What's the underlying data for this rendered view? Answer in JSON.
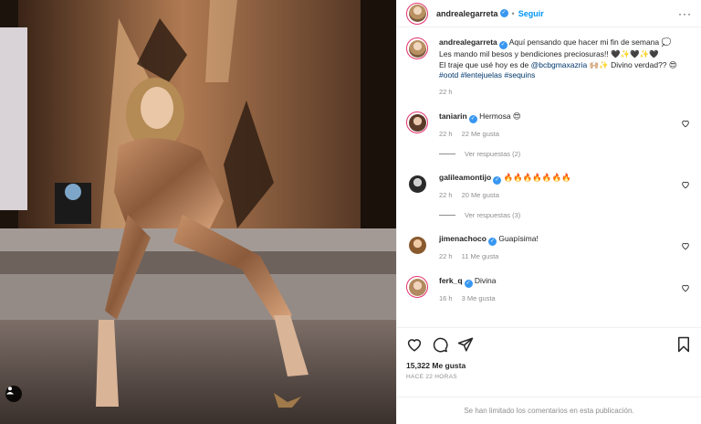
{
  "post": {
    "username": "andrealegarreta",
    "follow_label": "Seguir",
    "more_label": "···",
    "caption": {
      "username": "andrealegarreta",
      "line1": "Aquí pensando que hacer mi fin de semana 💭",
      "line2": "Les mando mil besos y bendiciones preciosuras!! 🖤✨🖤✨🖤",
      "line3_prefix": "El traje que usé hoy es de ",
      "line3_link": "@bcbgmaxazria",
      "line3_suffix": " 🙌🏼✨ Divino verdad?? 😍 ",
      "hashtags": "#ootd #lentejuelas #sequins",
      "time": "22 h"
    },
    "comments": [
      {
        "username": "taniarin",
        "text": "Hermosa 😍",
        "time": "22 h",
        "likes": "22 Me gusta",
        "replies": "Ver respuestas (2)"
      },
      {
        "username": "galileamontijo",
        "text": "🔥🔥🔥🔥🔥🔥🔥",
        "time": "22 h",
        "likes": "20 Me gusta",
        "replies": "Ver respuestas (3)"
      },
      {
        "username": "jimenachoco",
        "text": "Guapísima!",
        "time": "22 h",
        "likes": "11 Me gusta",
        "replies": ""
      },
      {
        "username": "ferk_q",
        "text": "Divina",
        "time": "16 h",
        "likes": "3 Me gusta",
        "replies": ""
      }
    ],
    "likes_count": "15,322 Me gusta",
    "posted_ago": "HACE 22 HORAS",
    "comments_limited": "Se han limitado los comentarios en esta publicación."
  }
}
